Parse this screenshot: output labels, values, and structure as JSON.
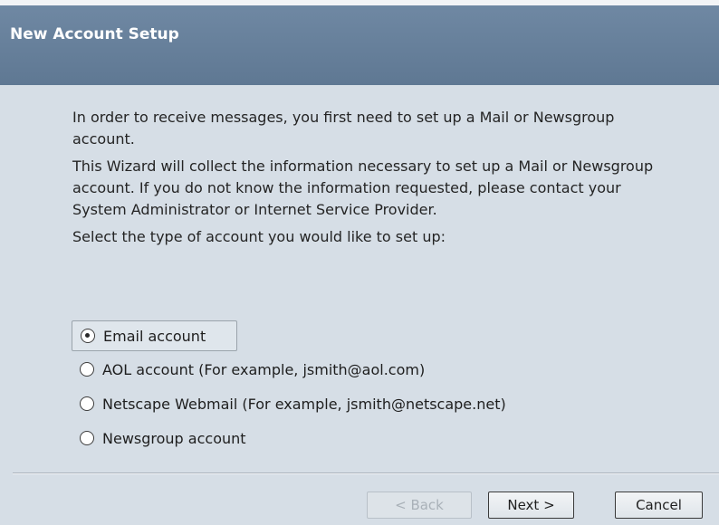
{
  "window": {
    "title": "New Account Setup"
  },
  "intro": {
    "para1": "In order to receive messages, you first need to set up a Mail or Newsgroup account.",
    "para2": "This Wizard will collect the information necessary to set up a Mail or Newsgroup account. If you do not know the information requested, please contact your System Administrator or Internet Service Provider.",
    "para3": "Select the type of account you would like to set up:"
  },
  "account_types": {
    "selected": "Email account",
    "options": [
      {
        "label": "Email account",
        "checked": true
      },
      {
        "label": "AOL account (For example, jsmith@aol.com)",
        "checked": false
      },
      {
        "label": "Netscape Webmail (For example, jsmith@netscape.net)",
        "checked": false
      },
      {
        "label": "Newsgroup account",
        "checked": false
      }
    ]
  },
  "buttons": {
    "back": "< Back",
    "next": "Next >",
    "cancel": "Cancel"
  },
  "colors": {
    "title_bar": "#6a84a0",
    "background": "#d6dee6"
  }
}
